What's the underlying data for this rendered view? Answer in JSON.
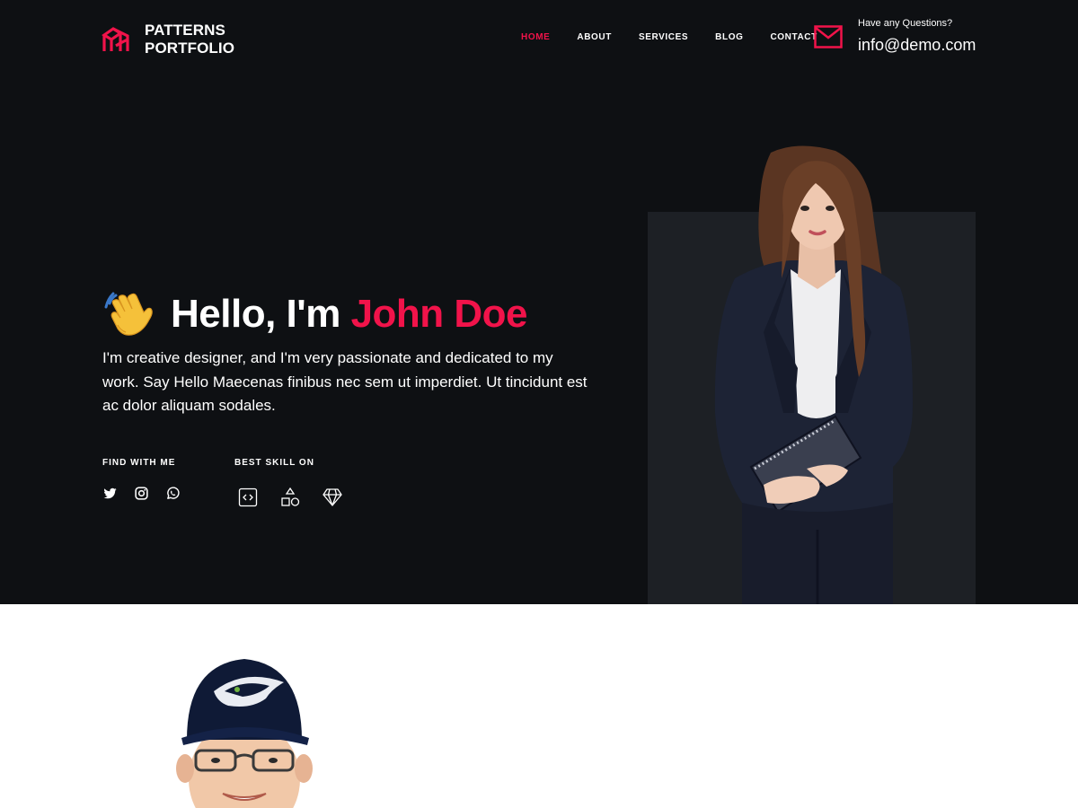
{
  "brand": {
    "line1": "PATTERNS",
    "line2": "PORTFOLIO",
    "accent_color": "#f1134a"
  },
  "nav": {
    "items": [
      {
        "label": "HOME",
        "active": true
      },
      {
        "label": "ABOUT",
        "active": false
      },
      {
        "label": "SERVICES",
        "active": false
      },
      {
        "label": "BLOG",
        "active": false
      },
      {
        "label": "CONTACT",
        "active": false
      }
    ]
  },
  "contact": {
    "question": "Have any Questions?",
    "email": "info@demo.com",
    "icon": "mail-icon"
  },
  "hero": {
    "greeting_prefix": "Hello, I'm ",
    "name": "John Doe",
    "emoji": "waving-hand-icon",
    "intro": "I'm creative designer, and I'm very passionate and dedicated to my work. Say Hello Maecenas finibus nec sem ut imperdiet. Ut tincidunt est ac dolor aliquam sodales.",
    "find_label": "FIND WITH ME",
    "skill_label": "BEST SKILL ON",
    "social_icons": [
      "twitter-icon",
      "instagram-icon",
      "whatsapp-icon"
    ],
    "skill_icons": [
      "code-icon",
      "shapes-icon",
      "diamond-icon"
    ]
  },
  "colors": {
    "background": "#0e1013",
    "panel": "#1d2025",
    "accent": "#f1134a"
  }
}
